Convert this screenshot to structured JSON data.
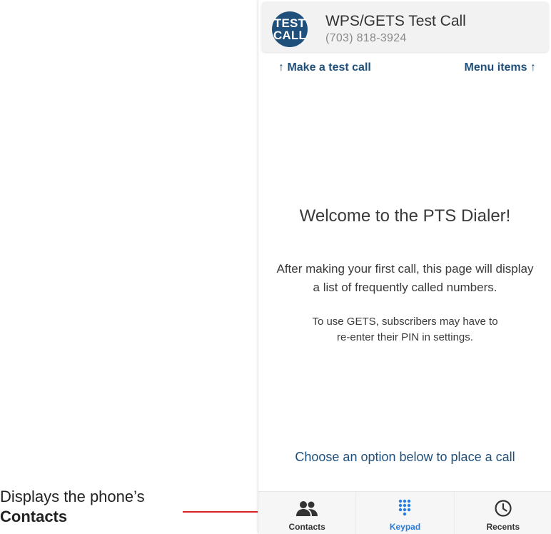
{
  "test_call": {
    "badge_line1": "TEST",
    "badge_line2": "CALL",
    "title": "WPS/GETS Test Call",
    "number": "(703) 818-3924"
  },
  "hints": {
    "left": "↑  Make a test call",
    "right": "Menu items  ↑"
  },
  "welcome": {
    "title": "Welcome to the PTS Dialer!",
    "line1": "After making your first call, this page will display",
    "line2": "a list of frequently called numbers.",
    "gets_line1": "To use GETS, subscribers may have to",
    "gets_line2": "re-enter their PIN in settings."
  },
  "prompt": "Choose an option below to place a call",
  "tabs": [
    {
      "label": "Contacts",
      "icon": "contacts-icon",
      "active": false
    },
    {
      "label": "Keypad",
      "icon": "keypad-icon",
      "active": true
    },
    {
      "label": "Recents",
      "icon": "clock-icon",
      "active": false
    }
  ],
  "callout": {
    "line1": "Displays the phone’s",
    "line2": "Contacts"
  },
  "colors": {
    "brand": "#1f4f7b",
    "active_tab": "#2a7de1",
    "callout_line": "#d9222a"
  }
}
